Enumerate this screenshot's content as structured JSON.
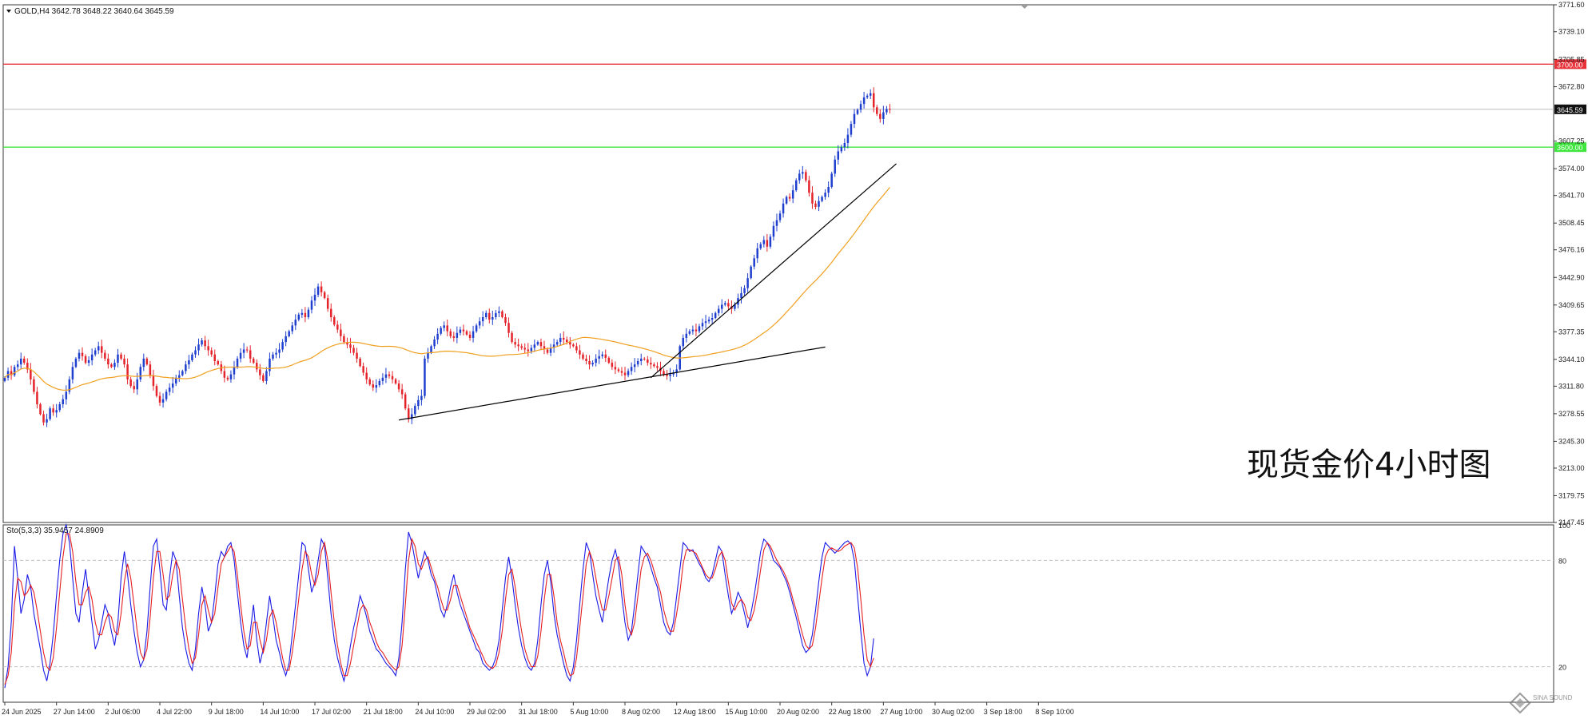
{
  "symbol_header": "GOLD,H4  3642.78 3648.22 3640.64 3645.59",
  "oscillator_header": "Sto(5,3,3) 35.9457 24.8909",
  "annotation": "现货金价4小时图",
  "watermark": "SINA SOUND",
  "colors": {
    "bull": "#1f3fcf",
    "bear": "#e5232b",
    "ma": "#f0a020",
    "resistance": "#e8323a",
    "support": "#3ee63e",
    "current": "#b0b0b0",
    "k_line": "#1a1ae6",
    "d_line": "#e62020",
    "trend": "#000000"
  },
  "chart_data": [
    {
      "type": "candlestick",
      "title": "",
      "price_axis": {
        "min": 3147.45,
        "max": 3771.6,
        "ticks": [
          3771.6,
          3739.1,
          3705.85,
          3672.8,
          3607.25,
          3574.0,
          3541.7,
          3508.45,
          3476.16,
          3442.9,
          3409.65,
          3377.35,
          3344.1,
          3311.8,
          3278.55,
          3245.3,
          3213.0,
          3179.75,
          3147.45
        ]
      },
      "time_axis": {
        "labels": [
          "24 Jun 2025",
          "27 Jun 14:00",
          "2 Jul 06:00",
          "4 Jul 22:00",
          "9 Jul 18:00",
          "14 Jul 10:00",
          "17 Jul 02:00",
          "21 Jul 18:00",
          "24 Jul 10:00",
          "29 Jul 02:00",
          "31 Jul 18:00",
          "5 Aug 10:00",
          "8 Aug 02:00",
          "12 Aug 18:00",
          "15 Aug 10:00",
          "20 Aug 02:00",
          "22 Aug 18:00",
          "27 Aug 10:00",
          "30 Aug 02:00",
          "3 Sep 18:00",
          "8 Sep 10:00"
        ],
        "label_bars": [
          0,
          16,
          32,
          48,
          64,
          80,
          96,
          112,
          128,
          144,
          160,
          176,
          192,
          208,
          224,
          240,
          256,
          272,
          288,
          304,
          320
        ],
        "total_slots": 480
      },
      "ohlc_series": {
        "name": "",
        "close": [
          3322,
          3330,
          3325,
          3335,
          3338,
          3345,
          3340,
          3332,
          3320,
          3305,
          3290,
          3278,
          3268,
          3272,
          3285,
          3280,
          3283,
          3290,
          3296,
          3305,
          3320,
          3335,
          3345,
          3352,
          3348,
          3340,
          3343,
          3350,
          3355,
          3360,
          3352,
          3345,
          3338,
          3335,
          3340,
          3350,
          3345,
          3338,
          3320,
          3312,
          3308,
          3320,
          3335,
          3345,
          3338,
          3325,
          3312,
          3300,
          3292,
          3296,
          3305,
          3310,
          3315,
          3322,
          3325,
          3330,
          3338,
          3343,
          3350,
          3355,
          3362,
          3367,
          3360,
          3355,
          3350,
          3342,
          3338,
          3330,
          3322,
          3320,
          3326,
          3335,
          3345,
          3352,
          3356,
          3355,
          3345,
          3340,
          3332,
          3325,
          3318,
          3330,
          3345,
          3350,
          3352,
          3356,
          3365,
          3372,
          3378,
          3385,
          3392,
          3398,
          3400,
          3395,
          3404,
          3415,
          3422,
          3432,
          3425,
          3418,
          3405,
          3395,
          3386,
          3380,
          3372,
          3365,
          3362,
          3358,
          3352,
          3345,
          3336,
          3328,
          3320,
          3314,
          3310,
          3313,
          3318,
          3322,
          3326,
          3324,
          3320,
          3315,
          3308,
          3302,
          3285,
          3272,
          3278,
          3288,
          3295,
          3300,
          3345,
          3352,
          3360,
          3368,
          3375,
          3382,
          3385,
          3378,
          3372,
          3370,
          3376,
          3380,
          3378,
          3374,
          3370,
          3378,
          3385,
          3390,
          3395,
          3400,
          3392,
          3395,
          3400,
          3402,
          3395,
          3388,
          3376,
          3365,
          3362,
          3360,
          3358,
          3356,
          3354,
          3358,
          3362,
          3365,
          3360,
          3356,
          3352,
          3358,
          3362,
          3365,
          3370,
          3368,
          3365,
          3362,
          3360,
          3355,
          3350,
          3345,
          3342,
          3338,
          3340,
          3345,
          3348,
          3350,
          3346,
          3340,
          3335,
          3332,
          3330,
          3328,
          3325,
          3330,
          3335,
          3338,
          3342,
          3345,
          3344,
          3340,
          3338,
          3336,
          3334,
          3330,
          3326,
          3324,
          3326,
          3328,
          3332,
          3360,
          3370,
          3375,
          3378,
          3380,
          3378,
          3384,
          3388,
          3390,
          3392,
          3394,
          3400,
          3405,
          3410,
          3412,
          3408,
          3405,
          3410,
          3418,
          3424,
          3430,
          3442,
          3456,
          3466,
          3478,
          3483,
          3488,
          3480,
          3492,
          3505,
          3512,
          3520,
          3532,
          3540,
          3538,
          3548,
          3560,
          3568,
          3570,
          3560,
          3545,
          3532,
          3528,
          3535,
          3540,
          3545,
          3552,
          3568,
          3585,
          3595,
          3600,
          3605,
          3615,
          3628,
          3640,
          3645,
          3652,
          3660,
          3662,
          3665,
          3648,
          3640,
          3634,
          3642,
          3646,
          3645.59
        ]
      },
      "ma_series": {
        "name": "",
        "period": 50
      },
      "hlines": [
        {
          "value": 3700.0,
          "label": "3700.00",
          "color": "#e8323a"
        },
        {
          "value": 3645.59,
          "label": "3645.59",
          "color": "#b0b0b0"
        },
        {
          "value": 3600.0,
          "label": "3600.00",
          "color": "#3ee63e"
        }
      ],
      "trendlines": [
        {
          "from": {
            "bar": 122,
            "price": 3271
          },
          "to": {
            "bar": 254,
            "price": 3359
          }
        },
        {
          "from": {
            "bar": 200,
            "price": 3322
          },
          "to": {
            "bar": 276,
            "price": 3580
          }
        }
      ],
      "annotations": [
        "现货金价4小时图"
      ]
    },
    {
      "type": "line",
      "title": "Sto(5,3,3) 35.9457 24.8909",
      "y_axis": {
        "min": 0,
        "max": 100,
        "ticks": [
          100,
          80,
          20
        ]
      },
      "levels": [
        80,
        20
      ],
      "series": [
        {
          "name": "",
          "values": [
            8,
            20,
            45,
            88,
            70,
            50,
            58,
            72,
            65,
            50,
            40,
            30,
            18,
            12,
            22,
            38,
            60,
            80,
            95,
            100,
            90,
            70,
            50,
            45,
            62,
            75,
            60,
            45,
            30,
            35,
            45,
            55,
            50,
            40,
            32,
            45,
            70,
            85,
            72,
            55,
            40,
            28,
            20,
            24,
            40,
            65,
            88,
            92,
            75,
            55,
            52,
            70,
            85,
            80,
            60,
            42,
            30,
            22,
            18,
            30,
            50,
            65,
            55,
            40,
            45,
            60,
            78,
            85,
            82,
            88,
            90,
            80,
            62,
            45,
            32,
            25,
            40,
            55,
            35,
            22,
            30,
            45,
            60,
            48,
            35,
            28,
            20,
            15,
            22,
            38,
            55,
            72,
            90,
            88,
            75,
            62,
            68,
            80,
            92,
            88,
            70,
            50,
            35,
            25,
            18,
            12,
            20,
            32,
            42,
            50,
            60,
            55,
            48,
            40,
            35,
            30,
            28,
            25,
            22,
            20,
            18,
            15,
            25,
            45,
            75,
            96,
            90,
            80,
            70,
            78,
            85,
            80,
            72,
            68,
            60,
            52,
            48,
            55,
            65,
            72,
            62,
            55,
            50,
            45,
            40,
            35,
            30,
            28,
            22,
            20,
            18,
            20,
            25,
            35,
            52,
            70,
            82,
            70,
            55,
            42,
            32,
            25,
            20,
            18,
            22,
            35,
            55,
            72,
            80,
            68,
            50,
            38,
            30,
            22,
            15,
            12,
            20,
            35,
            55,
            75,
            90,
            85,
            72,
            60,
            52,
            45,
            58,
            70,
            80,
            86,
            78,
            60,
            45,
            35,
            40,
            55,
            72,
            88,
            85,
            82,
            76,
            70,
            65,
            55,
            45,
            40,
            38,
            45,
            60,
            75,
            90,
            88,
            85,
            86,
            82,
            78,
            75,
            70,
            68,
            72,
            80,
            88,
            85,
            72,
            60,
            50,
            55,
            62,
            58,
            50,
            42,
            50,
            60,
            72,
            85,
            92,
            90,
            86,
            80,
            78,
            76,
            72,
            68,
            62,
            55,
            48,
            40,
            32,
            28,
            30,
            38,
            52,
            68,
            82,
            90,
            88,
            86,
            84,
            86,
            88,
            90,
            91,
            89,
            80,
            60,
            40,
            22,
            15,
            20,
            35.9457
          ]
        },
        {
          "name": "",
          "values": [
            10,
            15,
            28,
            55,
            70,
            68,
            60,
            62,
            66,
            62,
            52,
            40,
            28,
            20,
            18,
            25,
            42,
            62,
            82,
            95,
            95,
            85,
            68,
            55,
            55,
            62,
            65,
            58,
            45,
            38,
            38,
            45,
            50,
            48,
            40,
            38,
            50,
            68,
            78,
            70,
            55,
            40,
            28,
            24,
            30,
            48,
            70,
            85,
            85,
            72,
            58,
            60,
            72,
            80,
            75,
            58,
            42,
            30,
            22,
            25,
            38,
            55,
            60,
            52,
            45,
            50,
            65,
            78,
            82,
            85,
            88,
            85,
            72,
            55,
            40,
            30,
            32,
            45,
            45,
            35,
            28,
            35,
            48,
            52,
            45,
            35,
            25,
            18,
            18,
            28,
            42,
            58,
            75,
            85,
            82,
            72,
            66,
            72,
            85,
            90,
            80,
            62,
            45,
            32,
            22,
            15,
            15,
            22,
            32,
            42,
            52,
            55,
            52,
            45,
            40,
            34,
            30,
            28,
            25,
            22,
            20,
            18,
            20,
            32,
            55,
            80,
            92,
            88,
            78,
            75,
            80,
            82,
            76,
            70,
            65,
            58,
            52,
            52,
            58,
            66,
            66,
            60,
            54,
            48,
            42,
            38,
            34,
            30,
            26,
            22,
            20,
            19,
            21,
            28,
            40,
            58,
            72,
            75,
            65,
            52,
            40,
            30,
            24,
            20,
            20,
            26,
            40,
            58,
            72,
            72,
            60,
            45,
            35,
            28,
            20,
            15,
            16,
            25,
            42,
            60,
            78,
            85,
            80,
            70,
            60,
            52,
            52,
            60,
            70,
            80,
            82,
            72,
            55,
            42,
            38,
            45,
            60,
            75,
            82,
            84,
            80,
            74,
            68,
            62,
            52,
            45,
            40,
            40,
            50,
            62,
            78,
            86,
            86,
            85,
            84,
            80,
            76,
            72,
            70,
            70,
            75,
            82,
            85,
            80,
            68,
            56,
            52,
            56,
            58,
            55,
            48,
            46,
            52,
            62,
            75,
            86,
            90,
            88,
            84,
            80,
            77,
            74,
            70,
            65,
            58,
            52,
            45,
            38,
            32,
            30,
            32,
            42,
            56,
            70,
            82,
            86,
            87,
            86,
            85,
            86,
            88,
            89,
            90,
            87,
            76,
            58,
            38,
            24,
            20,
            24.8909
          ]
        }
      ]
    }
  ]
}
